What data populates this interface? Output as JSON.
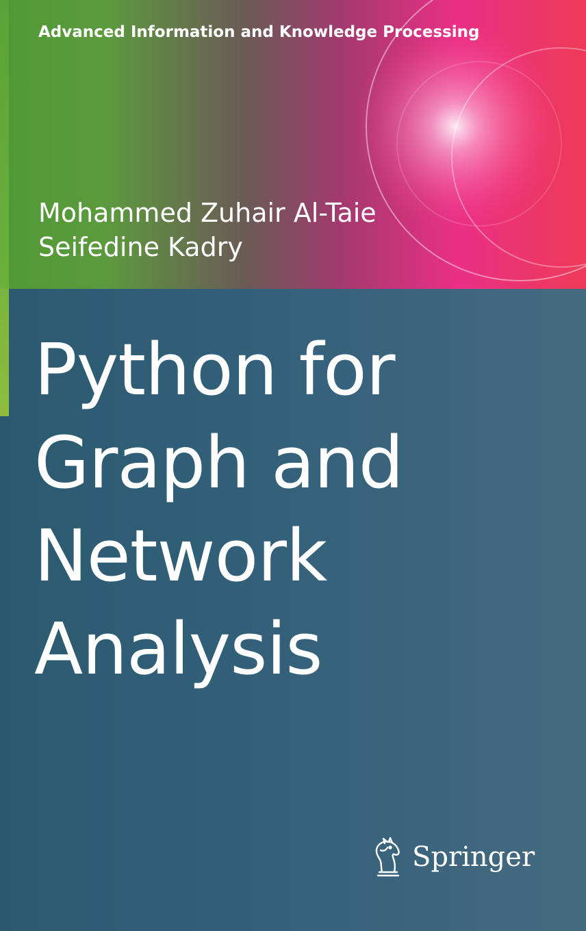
{
  "series": "Advanced Information and Knowledge Processing",
  "authors": [
    "Mohammed Zuhair Al-Taie",
    "Seifedine Kadry"
  ],
  "title_lines": [
    "Python for",
    "Graph and",
    "Network",
    "Analysis"
  ],
  "publisher": {
    "name": "Springer",
    "logo_icon": "springer-horse-icon"
  },
  "colors": {
    "green": "#5a9e3a",
    "magenta": "#ea2f86",
    "red": "#ee3a58",
    "teal": "#2f5d75",
    "text": "#ffffff"
  }
}
